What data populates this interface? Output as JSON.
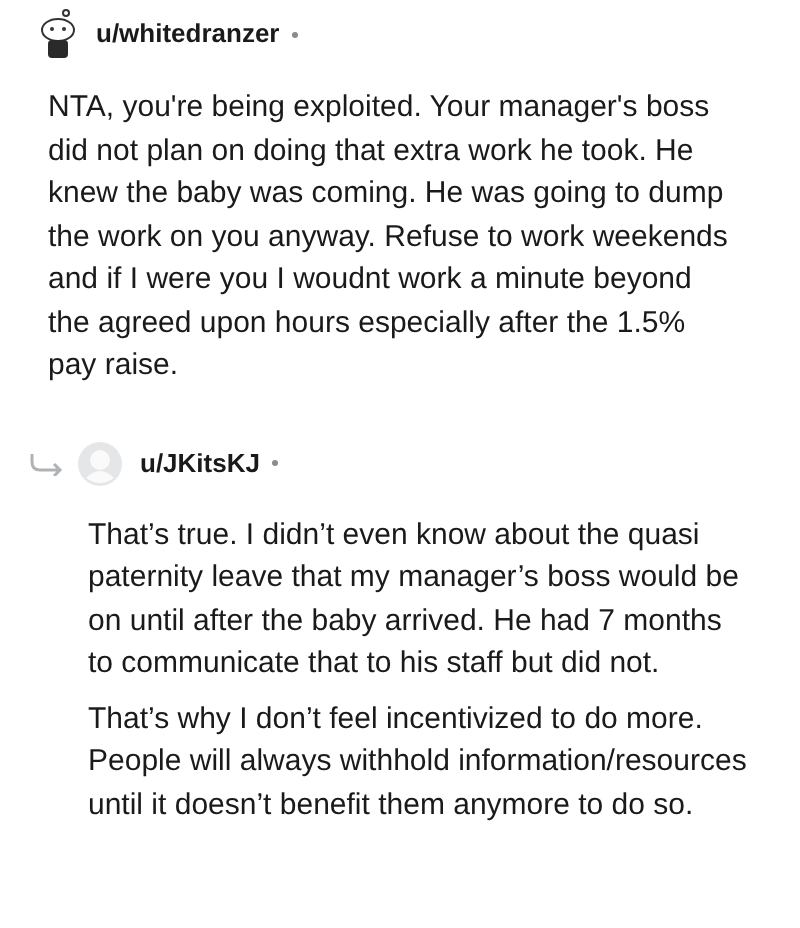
{
  "comments": [
    {
      "username": "u/whitedranzer",
      "is_reply": false,
      "paragraphs": [
        "NTA, you're being exploited. Your manager's boss did not plan on doing that extra work he took. He knew the baby was coming. He was going to dump the work on you anyway. Refuse to work weekends and if I were you I woudnt work a minute beyond the agreed upon hours especially after the 1.5% pay raise."
      ]
    },
    {
      "username": "u/JKitsKJ",
      "is_reply": true,
      "paragraphs": [
        "That’s true. I didn’t even know about the quasi paternity leave that my manager’s boss would be on until after the baby arrived. He had 7 months to communicate that to his staff but did not.",
        "That’s why I don’t feel incentivized to do more. People will always withhold information/resources until it doesn’t benefit them anymore to do so."
      ]
    }
  ]
}
